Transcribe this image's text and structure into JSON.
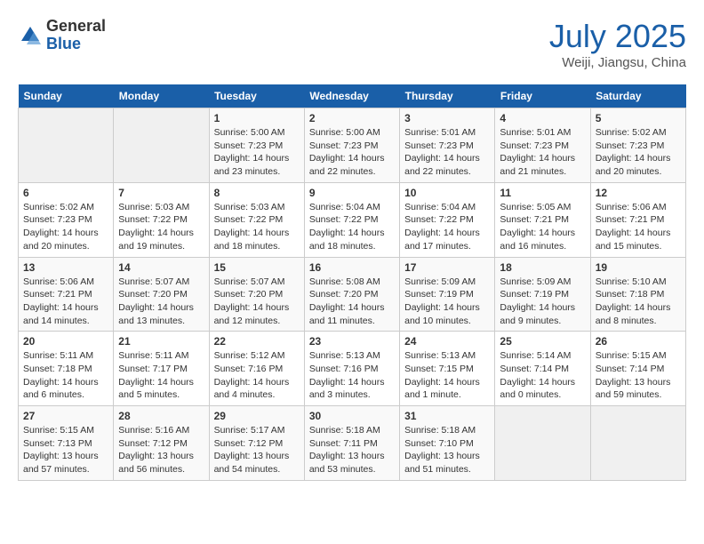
{
  "header": {
    "logo_general": "General",
    "logo_blue": "Blue",
    "month_title": "July 2025",
    "location": "Weiji, Jiangsu, China"
  },
  "weekdays": [
    "Sunday",
    "Monday",
    "Tuesday",
    "Wednesday",
    "Thursday",
    "Friday",
    "Saturday"
  ],
  "weeks": [
    [
      {
        "day": "",
        "detail": ""
      },
      {
        "day": "",
        "detail": ""
      },
      {
        "day": "1",
        "detail": "Sunrise: 5:00 AM\nSunset: 7:23 PM\nDaylight: 14 hours\nand 23 minutes."
      },
      {
        "day": "2",
        "detail": "Sunrise: 5:00 AM\nSunset: 7:23 PM\nDaylight: 14 hours\nand 22 minutes."
      },
      {
        "day": "3",
        "detail": "Sunrise: 5:01 AM\nSunset: 7:23 PM\nDaylight: 14 hours\nand 22 minutes."
      },
      {
        "day": "4",
        "detail": "Sunrise: 5:01 AM\nSunset: 7:23 PM\nDaylight: 14 hours\nand 21 minutes."
      },
      {
        "day": "5",
        "detail": "Sunrise: 5:02 AM\nSunset: 7:23 PM\nDaylight: 14 hours\nand 20 minutes."
      }
    ],
    [
      {
        "day": "6",
        "detail": "Sunrise: 5:02 AM\nSunset: 7:23 PM\nDaylight: 14 hours\nand 20 minutes."
      },
      {
        "day": "7",
        "detail": "Sunrise: 5:03 AM\nSunset: 7:22 PM\nDaylight: 14 hours\nand 19 minutes."
      },
      {
        "day": "8",
        "detail": "Sunrise: 5:03 AM\nSunset: 7:22 PM\nDaylight: 14 hours\nand 18 minutes."
      },
      {
        "day": "9",
        "detail": "Sunrise: 5:04 AM\nSunset: 7:22 PM\nDaylight: 14 hours\nand 18 minutes."
      },
      {
        "day": "10",
        "detail": "Sunrise: 5:04 AM\nSunset: 7:22 PM\nDaylight: 14 hours\nand 17 minutes."
      },
      {
        "day": "11",
        "detail": "Sunrise: 5:05 AM\nSunset: 7:21 PM\nDaylight: 14 hours\nand 16 minutes."
      },
      {
        "day": "12",
        "detail": "Sunrise: 5:06 AM\nSunset: 7:21 PM\nDaylight: 14 hours\nand 15 minutes."
      }
    ],
    [
      {
        "day": "13",
        "detail": "Sunrise: 5:06 AM\nSunset: 7:21 PM\nDaylight: 14 hours\nand 14 minutes."
      },
      {
        "day": "14",
        "detail": "Sunrise: 5:07 AM\nSunset: 7:20 PM\nDaylight: 14 hours\nand 13 minutes."
      },
      {
        "day": "15",
        "detail": "Sunrise: 5:07 AM\nSunset: 7:20 PM\nDaylight: 14 hours\nand 12 minutes."
      },
      {
        "day": "16",
        "detail": "Sunrise: 5:08 AM\nSunset: 7:20 PM\nDaylight: 14 hours\nand 11 minutes."
      },
      {
        "day": "17",
        "detail": "Sunrise: 5:09 AM\nSunset: 7:19 PM\nDaylight: 14 hours\nand 10 minutes."
      },
      {
        "day": "18",
        "detail": "Sunrise: 5:09 AM\nSunset: 7:19 PM\nDaylight: 14 hours\nand 9 minutes."
      },
      {
        "day": "19",
        "detail": "Sunrise: 5:10 AM\nSunset: 7:18 PM\nDaylight: 14 hours\nand 8 minutes."
      }
    ],
    [
      {
        "day": "20",
        "detail": "Sunrise: 5:11 AM\nSunset: 7:18 PM\nDaylight: 14 hours\nand 6 minutes."
      },
      {
        "day": "21",
        "detail": "Sunrise: 5:11 AM\nSunset: 7:17 PM\nDaylight: 14 hours\nand 5 minutes."
      },
      {
        "day": "22",
        "detail": "Sunrise: 5:12 AM\nSunset: 7:16 PM\nDaylight: 14 hours\nand 4 minutes."
      },
      {
        "day": "23",
        "detail": "Sunrise: 5:13 AM\nSunset: 7:16 PM\nDaylight: 14 hours\nand 3 minutes."
      },
      {
        "day": "24",
        "detail": "Sunrise: 5:13 AM\nSunset: 7:15 PM\nDaylight: 14 hours\nand 1 minute."
      },
      {
        "day": "25",
        "detail": "Sunrise: 5:14 AM\nSunset: 7:14 PM\nDaylight: 14 hours\nand 0 minutes."
      },
      {
        "day": "26",
        "detail": "Sunrise: 5:15 AM\nSunset: 7:14 PM\nDaylight: 13 hours\nand 59 minutes."
      }
    ],
    [
      {
        "day": "27",
        "detail": "Sunrise: 5:15 AM\nSunset: 7:13 PM\nDaylight: 13 hours\nand 57 minutes."
      },
      {
        "day": "28",
        "detail": "Sunrise: 5:16 AM\nSunset: 7:12 PM\nDaylight: 13 hours\nand 56 minutes."
      },
      {
        "day": "29",
        "detail": "Sunrise: 5:17 AM\nSunset: 7:12 PM\nDaylight: 13 hours\nand 54 minutes."
      },
      {
        "day": "30",
        "detail": "Sunrise: 5:18 AM\nSunset: 7:11 PM\nDaylight: 13 hours\nand 53 minutes."
      },
      {
        "day": "31",
        "detail": "Sunrise: 5:18 AM\nSunset: 7:10 PM\nDaylight: 13 hours\nand 51 minutes."
      },
      {
        "day": "",
        "detail": ""
      },
      {
        "day": "",
        "detail": ""
      }
    ]
  ]
}
